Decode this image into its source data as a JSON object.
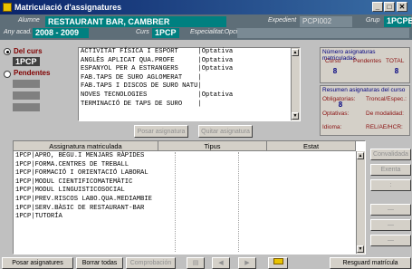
{
  "window": {
    "title": "Matriculació d'assignatures",
    "minimize": "_",
    "maximize": "□",
    "close": "✕"
  },
  "header": {
    "alumne_label": "Alumne",
    "alumne_value": "RESTAURANT BAR, CAMBRER",
    "expedient_label": "Expedient",
    "expedient_value": "PCPI002",
    "grup_label": "Grup",
    "grup_value": "1PCPB",
    "any_label": "Any acad.",
    "any_value": "2008 - 2009",
    "curs_label": "Curs",
    "curs_value": "1PCP",
    "esp_label": "Especialitat:Opció"
  },
  "filters": {
    "del_curs": "Del curs",
    "del_curs_badge": "1PCP",
    "pendents": "Pendentes"
  },
  "subjects": [
    {
      "name": "ACTIVITAT FÍSICA I ESPORT",
      "type": "Optativa"
    },
    {
      "name": "ANGLÈS APLICAT QUA.PROFE",
      "type": "Optativa"
    },
    {
      "name": "ESPANYOL PER A ESTRANGERS",
      "type": "Optativa"
    },
    {
      "name": "FAB.TAPS DE SURO AGLOMERAT",
      "type": ""
    },
    {
      "name": "FAB.TAPS I DISCOS DE SURO NATU",
      "type": ""
    },
    {
      "name": "NOVES TECNOLOGIES",
      "type": "Optativa"
    },
    {
      "name": "TERMINACIÓ DE TAPS DE SURO",
      "type": ""
    }
  ],
  "mid_buttons": {
    "posar": "Posar asignatura",
    "quitar": "Quitar asignatura"
  },
  "stats": {
    "numero_title": "Número asignaturas matriculadas",
    "curs": "Curso",
    "pendents": "Pendentes",
    "total": "TOTAL",
    "curs_val": "8",
    "total_val": "8",
    "resum_title": "Resumen asignaturas del curso",
    "obligatorias": "Obligatorias:",
    "obligatorias_val": "8",
    "troncal": "Troncal/Espec.:",
    "optativas": "Optativas:",
    "modalidad": "De modalidad:",
    "idioma": "Idioma:",
    "rel": "REL/AE/HCR:"
  },
  "table": {
    "col1": "Assignatura matriculada",
    "col2": "Tipus",
    "col3": "Estat",
    "rows": [
      "1PCP|APRO, BEGU.I MENJARS RÀPIDES",
      "1PCP|FORMA.CENTRES DE TREBALL",
      "1PCP|FORMACIÓ I ORIENTACIÓ LABORAL",
      "1PCP|MODUL CIENTIFICOMATEMÀTIC",
      "1PCP|MODUL LINGUISTICOSOCIAL",
      "1PCP|PREV.RISCOS LABO.QUA.MEDIAMBIE",
      "1PCP|SERV.BÀSIC DE RESTAURANT-BAR",
      "1PCP|TUTORÍA"
    ]
  },
  "right_buttons": {
    "convalidada": "Convalidada",
    "exenta": "Exenta",
    "colon": ":",
    "dash1": "—",
    "dash2": "—",
    "dash3": "—"
  },
  "bottom": {
    "posar": "Posar asignatures",
    "borrar": "Borrar todas",
    "comprobacion": "Comprobación",
    "resguard": "Resguard matrícula"
  }
}
